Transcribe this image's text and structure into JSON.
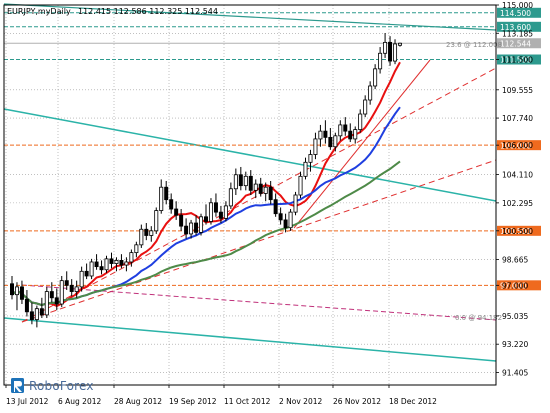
{
  "header": {
    "symbol_timeframe": "EURJPY,myDaily",
    "ohlc": "112.415 112.586 112.325 112.544"
  },
  "chart_data": {
    "type": "candlestick",
    "symbol": "EURJPY",
    "timeframe": "Daily",
    "ylim": [
      90.6,
      115.0
    ],
    "y_ticks": [
      "115.000",
      "113.185",
      "111.500",
      "109.555",
      "107.740",
      "106.000",
      "104.110",
      "102.295",
      "100.500",
      "98.665",
      "97.000",
      "95.035",
      "93.220",
      "91.405"
    ],
    "x_ticks": [
      "13 Jul 2012",
      "6 Aug 2012",
      "28 Aug 2012",
      "19 Sep 2012",
      "11 Oct 2012",
      "2 Nov 2012",
      "26 Nov 2012",
      "18 Dec 2012"
    ],
    "horizontal_levels": [
      {
        "value": 114.5,
        "label": "114.500",
        "color": "#2d9a8e"
      },
      {
        "value": 113.6,
        "label": "113.600",
        "color": "#2d9a8e"
      },
      {
        "value": 112.544,
        "label": "112.544",
        "color": "#b0b0b0"
      },
      {
        "value": 111.5,
        "label": "111.500",
        "color": "#2d9a8e"
      },
      {
        "value": 106.0,
        "label": "106.000",
        "color": "#ef6a1e"
      },
      {
        "value": 100.5,
        "label": "100.500",
        "color": "#ef6a1e"
      },
      {
        "value": 97.0,
        "label": "97.000",
        "color": "#ef6a1e"
      }
    ],
    "fib_labels": [
      "23.6 @ 112.008",
      "0.0 @ 94.182"
    ],
    "ma_series": [
      {
        "color": "#e81010"
      },
      {
        "color": "#1f3fe0"
      },
      {
        "color": "#4e8a48"
      }
    ],
    "candles": [
      {
        "o": 97.1,
        "h": 97.6,
        "l": 96.1,
        "c": 96.4
      },
      {
        "o": 96.4,
        "h": 97.2,
        "l": 95.4,
        "c": 96.9
      },
      {
        "o": 96.9,
        "h": 97.3,
        "l": 95.8,
        "c": 96.1
      },
      {
        "o": 96.1,
        "h": 96.7,
        "l": 95.0,
        "c": 95.3
      },
      {
        "o": 95.3,
        "h": 95.9,
        "l": 94.5,
        "c": 94.8
      },
      {
        "o": 94.8,
        "h": 95.7,
        "l": 94.3,
        "c": 95.5
      },
      {
        "o": 95.5,
        "h": 96.2,
        "l": 94.9,
        "c": 95.1
      },
      {
        "o": 95.1,
        "h": 96.9,
        "l": 94.9,
        "c": 96.6
      },
      {
        "o": 96.6,
        "h": 97.2,
        "l": 95.9,
        "c": 96.2
      },
      {
        "o": 96.2,
        "h": 96.8,
        "l": 95.4,
        "c": 95.8
      },
      {
        "o": 95.8,
        "h": 97.6,
        "l": 95.6,
        "c": 97.3
      },
      {
        "o": 97.3,
        "h": 97.9,
        "l": 96.7,
        "c": 97.0
      },
      {
        "o": 97.0,
        "h": 97.4,
        "l": 96.3,
        "c": 96.6
      },
      {
        "o": 96.6,
        "h": 97.3,
        "l": 96.2,
        "c": 96.9
      },
      {
        "o": 96.9,
        "h": 98.2,
        "l": 96.6,
        "c": 97.9
      },
      {
        "o": 97.9,
        "h": 98.4,
        "l": 97.4,
        "c": 97.6
      },
      {
        "o": 97.6,
        "h": 98.7,
        "l": 97.4,
        "c": 98.5
      },
      {
        "o": 98.5,
        "h": 99.0,
        "l": 98.0,
        "c": 98.2
      },
      {
        "o": 98.2,
        "h": 98.6,
        "l": 97.7,
        "c": 98.0
      },
      {
        "o": 98.0,
        "h": 98.9,
        "l": 97.8,
        "c": 98.7
      },
      {
        "o": 98.7,
        "h": 99.1,
        "l": 98.1,
        "c": 98.4
      },
      {
        "o": 98.4,
        "h": 98.8,
        "l": 97.9,
        "c": 98.6
      },
      {
        "o": 98.6,
        "h": 99.0,
        "l": 98.1,
        "c": 98.3
      },
      {
        "o": 98.3,
        "h": 98.8,
        "l": 97.9,
        "c": 98.5
      },
      {
        "o": 98.5,
        "h": 99.3,
        "l": 98.2,
        "c": 99.1
      },
      {
        "o": 99.1,
        "h": 99.8,
        "l": 98.8,
        "c": 99.6
      },
      {
        "o": 99.6,
        "h": 100.9,
        "l": 99.4,
        "c": 100.6
      },
      {
        "o": 100.6,
        "h": 101.0,
        "l": 99.9,
        "c": 100.2
      },
      {
        "o": 100.2,
        "h": 100.8,
        "l": 99.8,
        "c": 100.5
      },
      {
        "o": 100.5,
        "h": 102.0,
        "l": 100.3,
        "c": 101.8
      },
      {
        "o": 101.8,
        "h": 103.8,
        "l": 101.6,
        "c": 103.3
      },
      {
        "o": 103.3,
        "h": 103.7,
        "l": 102.2,
        "c": 102.5
      },
      {
        "o": 102.5,
        "h": 102.9,
        "l": 101.6,
        "c": 101.9
      },
      {
        "o": 101.9,
        "h": 102.4,
        "l": 101.2,
        "c": 101.5
      },
      {
        "o": 101.5,
        "h": 101.9,
        "l": 100.5,
        "c": 100.8
      },
      {
        "o": 100.8,
        "h": 101.3,
        "l": 100.0,
        "c": 100.3
      },
      {
        "o": 100.3,
        "h": 101.2,
        "l": 100.0,
        "c": 101.0
      },
      {
        "o": 101.0,
        "h": 101.5,
        "l": 100.2,
        "c": 100.4
      },
      {
        "o": 100.4,
        "h": 101.6,
        "l": 100.2,
        "c": 101.4
      },
      {
        "o": 101.4,
        "h": 102.2,
        "l": 100.9,
        "c": 101.1
      },
      {
        "o": 101.1,
        "h": 102.6,
        "l": 100.9,
        "c": 102.3
      },
      {
        "o": 102.3,
        "h": 102.9,
        "l": 101.4,
        "c": 101.7
      },
      {
        "o": 101.7,
        "h": 102.1,
        "l": 101.0,
        "c": 101.3
      },
      {
        "o": 101.3,
        "h": 102.4,
        "l": 101.1,
        "c": 102.1
      },
      {
        "o": 102.1,
        "h": 103.6,
        "l": 101.9,
        "c": 103.2
      },
      {
        "o": 103.2,
        "h": 104.5,
        "l": 102.8,
        "c": 104.1
      },
      {
        "o": 104.1,
        "h": 104.6,
        "l": 103.1,
        "c": 103.4
      },
      {
        "o": 103.4,
        "h": 104.3,
        "l": 103.1,
        "c": 104.0
      },
      {
        "o": 104.0,
        "h": 104.4,
        "l": 102.8,
        "c": 103.1
      },
      {
        "o": 103.1,
        "h": 103.8,
        "l": 102.6,
        "c": 103.5
      },
      {
        "o": 103.5,
        "h": 103.9,
        "l": 102.7,
        "c": 102.9
      },
      {
        "o": 102.9,
        "h": 103.6,
        "l": 102.4,
        "c": 103.3
      },
      {
        "o": 103.3,
        "h": 103.7,
        "l": 102.2,
        "c": 102.5
      },
      {
        "o": 102.5,
        "h": 102.9,
        "l": 101.4,
        "c": 101.6
      },
      {
        "o": 101.6,
        "h": 102.0,
        "l": 100.9,
        "c": 101.2
      },
      {
        "o": 101.2,
        "h": 101.6,
        "l": 100.4,
        "c": 100.7
      },
      {
        "o": 100.7,
        "h": 101.9,
        "l": 100.5,
        "c": 101.7
      },
      {
        "o": 101.7,
        "h": 103.0,
        "l": 101.5,
        "c": 102.8
      },
      {
        "o": 102.8,
        "h": 104.3,
        "l": 102.6,
        "c": 104.0
      },
      {
        "o": 104.0,
        "h": 105.2,
        "l": 103.8,
        "c": 104.9
      },
      {
        "o": 104.9,
        "h": 105.7,
        "l": 104.3,
        "c": 105.4
      },
      {
        "o": 105.4,
        "h": 106.8,
        "l": 105.1,
        "c": 106.4
      },
      {
        "o": 106.4,
        "h": 107.3,
        "l": 105.9,
        "c": 106.9
      },
      {
        "o": 106.9,
        "h": 107.6,
        "l": 106.1,
        "c": 106.5
      },
      {
        "o": 106.5,
        "h": 107.1,
        "l": 105.7,
        "c": 105.9
      },
      {
        "o": 105.9,
        "h": 106.8,
        "l": 105.6,
        "c": 106.6
      },
      {
        "o": 106.6,
        "h": 107.6,
        "l": 106.3,
        "c": 107.3
      },
      {
        "o": 107.3,
        "h": 107.8,
        "l": 106.6,
        "c": 106.9
      },
      {
        "o": 106.9,
        "h": 107.4,
        "l": 106.2,
        "c": 106.4
      },
      {
        "o": 106.4,
        "h": 107.2,
        "l": 106.1,
        "c": 107.0
      },
      {
        "o": 107.0,
        "h": 108.3,
        "l": 106.8,
        "c": 108.0
      },
      {
        "o": 108.0,
        "h": 109.2,
        "l": 107.8,
        "c": 108.9
      },
      {
        "o": 108.9,
        "h": 110.1,
        "l": 108.6,
        "c": 109.8
      },
      {
        "o": 109.8,
        "h": 111.2,
        "l": 109.6,
        "c": 110.9
      },
      {
        "o": 110.9,
        "h": 112.3,
        "l": 110.6,
        "c": 111.9
      },
      {
        "o": 111.9,
        "h": 113.2,
        "l": 111.6,
        "c": 112.6
      },
      {
        "o": 112.6,
        "h": 113.0,
        "l": 111.1,
        "c": 111.4
      },
      {
        "o": 111.4,
        "h": 112.8,
        "l": 111.2,
        "c": 112.5
      },
      {
        "o": 112.415,
        "h": 112.586,
        "l": 112.325,
        "c": 112.544
      }
    ]
  },
  "watermark": {
    "brand": "RoboForex"
  }
}
